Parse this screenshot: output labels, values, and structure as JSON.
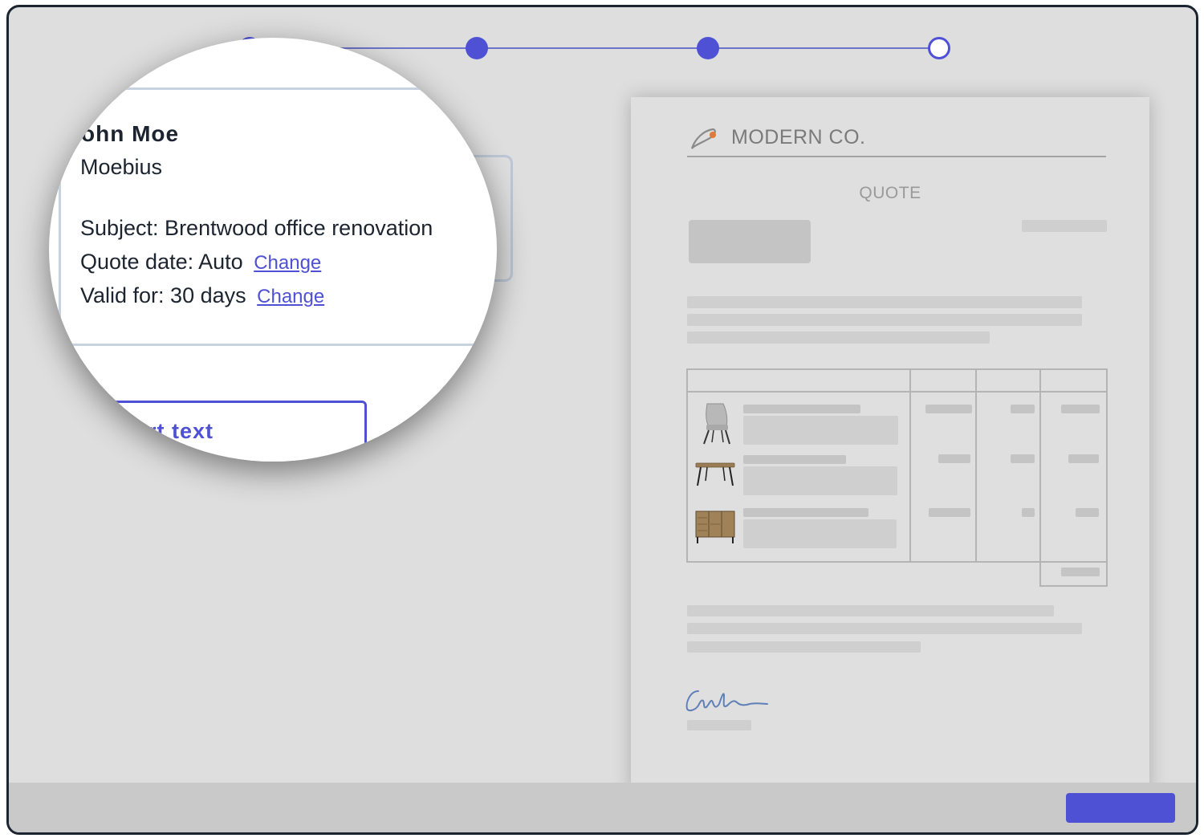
{
  "stepper": {
    "steps": [
      {
        "state": "complete"
      },
      {
        "state": "complete"
      },
      {
        "state": "complete"
      },
      {
        "state": "upcoming"
      }
    ],
    "accent_color": "#4f51d4"
  },
  "magnifier": {
    "client_name": "ohn Moe",
    "client_company": "Moebius",
    "subject_line": "Subject: Brentwood office renovation",
    "quote_date_label": "Quote date: Auto",
    "valid_for_label": "Valid for: 30 days",
    "change_link": "Change",
    "insert_text_button": "rt text"
  },
  "document": {
    "brand": "MODERN CO.",
    "title": "QUOTE",
    "logo_icon": "brush-logo-icon",
    "items": [
      {
        "icon": "chair-icon"
      },
      {
        "icon": "table-icon"
      },
      {
        "icon": "sideboard-icon"
      }
    ],
    "signature_icon": "signature-scribble"
  },
  "footer": {
    "next_button_color": "#4f51d4"
  }
}
